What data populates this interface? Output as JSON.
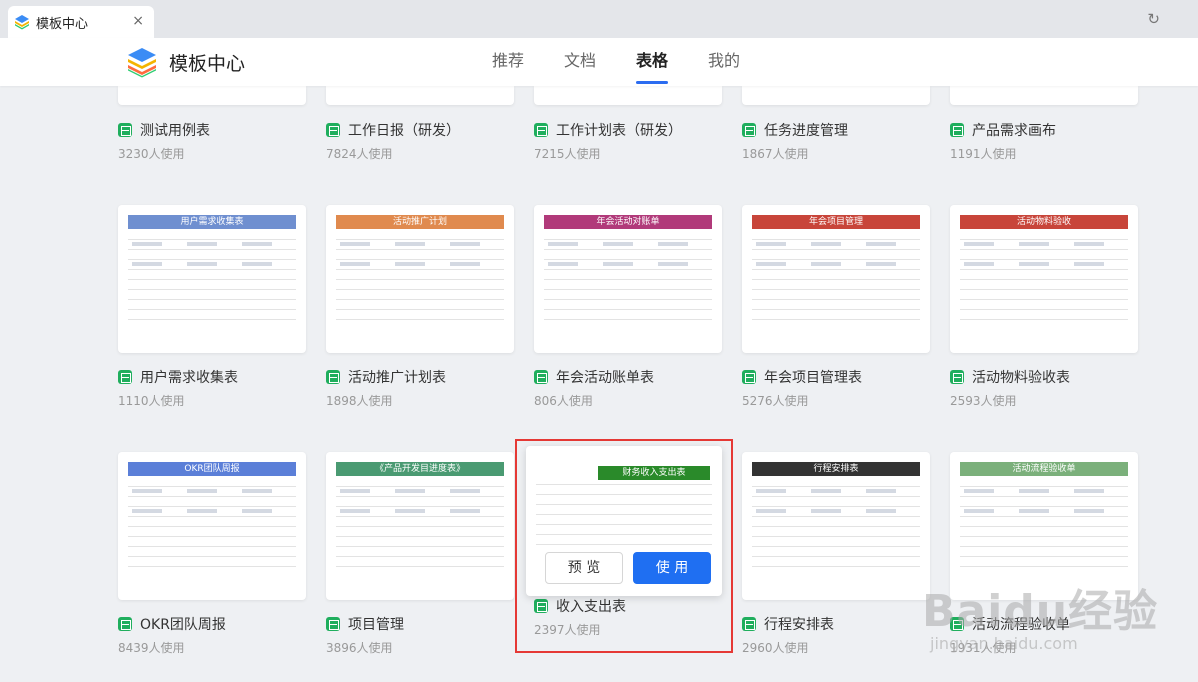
{
  "window": {
    "tab_title": "模板中心",
    "close_glyph": "×",
    "refresh_glyph": "↻"
  },
  "header": {
    "brand": "模板中心",
    "nav": [
      "推荐",
      "文档",
      "表格",
      "我的"
    ],
    "active_nav": "表格"
  },
  "rows": [
    [
      {
        "title": "测试用例表",
        "usage": "3230人使用"
      },
      {
        "title": "工作日报（研发）",
        "usage": "7824人使用"
      },
      {
        "title": "工作计划表（研发）",
        "usage": "7215人使用"
      },
      {
        "title": "任务进度管理",
        "usage": "1867人使用"
      },
      {
        "title": "产品需求画布",
        "usage": "1191人使用"
      }
    ],
    [
      {
        "title": "用户需求收集表",
        "usage": "1110人使用",
        "banner": "用户需求收集表",
        "color": "#6f8fd0"
      },
      {
        "title": "活动推广计划表",
        "usage": "1898人使用",
        "banner": "活动推广计划",
        "color": "#e08a4e"
      },
      {
        "title": "年会活动账单表",
        "usage": "806人使用",
        "banner": "年会活动对账单",
        "color": "#b13a7a"
      },
      {
        "title": "年会项目管理表",
        "usage": "5276人使用",
        "banner": "年会项目管理",
        "color": "#c8453a"
      },
      {
        "title": "活动物料验收表",
        "usage": "2593人使用",
        "banner": "活动物料验收",
        "color": "#c8453a"
      }
    ],
    [
      {
        "title": "OKR团队周报",
        "usage": "8439人使用",
        "banner": "OKR团队周报",
        "color": "#5b7fd8"
      },
      {
        "title": "项目管理",
        "usage": "3896人使用",
        "banner": "《产品开发目进度表》",
        "color": "#4a9a72"
      },
      {
        "title": "收入支出表",
        "usage": "2397人使用",
        "banner": "财务收入支出表",
        "color": "#2a8a2a"
      },
      {
        "title": "行程安排表",
        "usage": "2960人使用",
        "banner": "行程安排表",
        "color": "#333333"
      },
      {
        "title": "活动流程验收单",
        "usage": "1931人使用",
        "banner": "活动流程验收单",
        "color": "#7bb07b"
      }
    ]
  ],
  "hover_actions": {
    "preview": "预 览",
    "use": "使 用"
  },
  "watermark": {
    "main": "Baidu经验",
    "sub": "jingyan.baidu.com"
  },
  "colors": {
    "accent": "#1f6ff2",
    "sheet_icon": "#1fae5d",
    "highlight": "#e53935"
  }
}
